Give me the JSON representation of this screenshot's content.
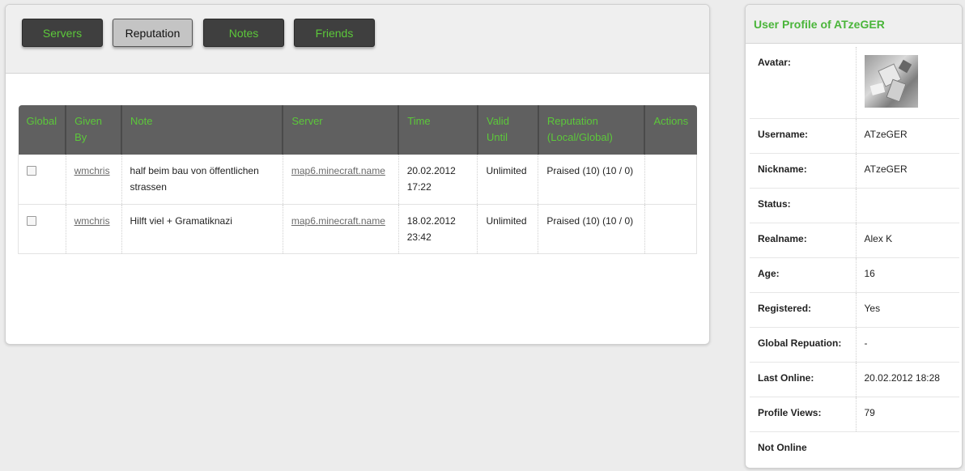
{
  "tabs": [
    {
      "label": "Servers",
      "active": false
    },
    {
      "label": "Reputation",
      "active": true
    },
    {
      "label": "Notes",
      "active": false
    },
    {
      "label": "Friends",
      "active": false
    }
  ],
  "reputation_table": {
    "columns": [
      {
        "line1": "Global",
        "line2": ""
      },
      {
        "line1": "Given",
        "line2": "By"
      },
      {
        "line1": "Note",
        "line2": ""
      },
      {
        "line1": "Server",
        "line2": ""
      },
      {
        "line1": "Time",
        "line2": ""
      },
      {
        "line1": "Valid",
        "line2": "Until"
      },
      {
        "line1": "Reputation",
        "line2": "(Local/Global)"
      },
      {
        "line1": "Actions",
        "line2": ""
      }
    ],
    "rows": [
      {
        "given_by": "wmchris",
        "note_line1": "half beim bau von öffentlichen",
        "note_line2": "strassen",
        "server": "map6.minecraft.name",
        "time_date": "20.02.2012",
        "time_clock": "17:22",
        "valid_until": "Unlimited",
        "reputation": "Praised (10) (10 / 0)",
        "actions": ""
      },
      {
        "given_by": "wmchris",
        "note_line1": "Hilft viel + Gramatiknazi",
        "note_line2": "",
        "server": "map6.minecraft.name",
        "time_date": "18.02.2012",
        "time_clock": "23:42",
        "valid_until": "Unlimited",
        "reputation": "Praised (10) (10 / 0)",
        "actions": ""
      }
    ]
  },
  "profile": {
    "title": "User Profile of ATzeGER",
    "avatar_label": "Avatar:",
    "fields": [
      {
        "label": "Username:",
        "value": "ATzeGER"
      },
      {
        "label": "Nickname:",
        "value": "ATzeGER"
      },
      {
        "label": "Status:",
        "value": ""
      },
      {
        "label": "Realname:",
        "value": "Alex K"
      },
      {
        "label": "Age:",
        "value": "16"
      },
      {
        "label": "Registered:",
        "value": "Yes"
      },
      {
        "label": "Global Repuation:",
        "value": "-"
      },
      {
        "label": "Last Online:",
        "value": "20.02.2012 18:28"
      },
      {
        "label": "Profile Views:",
        "value": "79"
      }
    ],
    "online_status": "Not Online"
  },
  "colors": {
    "accent_green": "#5cc83a",
    "title_green": "#4ab53a",
    "tab_dark": "#3f3f3f",
    "tab_active": "#c4c4c4",
    "table_header": "#606060"
  }
}
